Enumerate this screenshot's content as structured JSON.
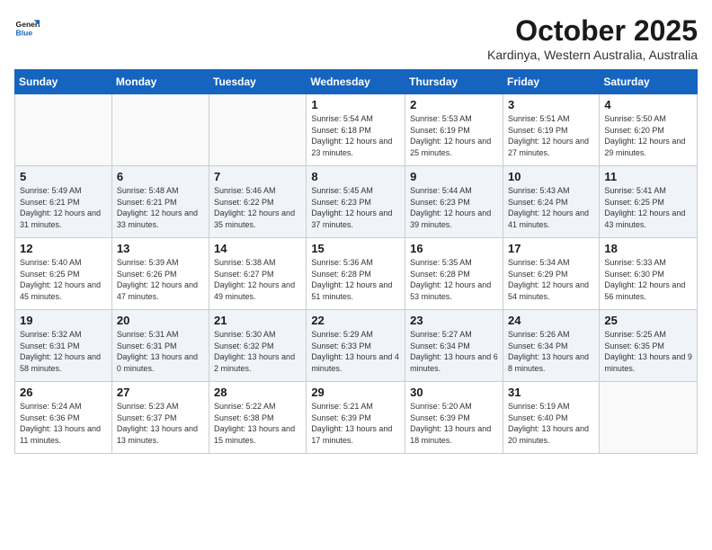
{
  "header": {
    "logo_line1": "General",
    "logo_line2": "Blue",
    "title": "October 2025",
    "location": "Kardinya, Western Australia, Australia"
  },
  "columns": [
    "Sunday",
    "Monday",
    "Tuesday",
    "Wednesday",
    "Thursday",
    "Friday",
    "Saturday"
  ],
  "weeks": [
    [
      {
        "day": "",
        "info": ""
      },
      {
        "day": "",
        "info": ""
      },
      {
        "day": "",
        "info": ""
      },
      {
        "day": "1",
        "info": "Sunrise: 5:54 AM\nSunset: 6:18 PM\nDaylight: 12 hours\nand 23 minutes."
      },
      {
        "day": "2",
        "info": "Sunrise: 5:53 AM\nSunset: 6:19 PM\nDaylight: 12 hours\nand 25 minutes."
      },
      {
        "day": "3",
        "info": "Sunrise: 5:51 AM\nSunset: 6:19 PM\nDaylight: 12 hours\nand 27 minutes."
      },
      {
        "day": "4",
        "info": "Sunrise: 5:50 AM\nSunset: 6:20 PM\nDaylight: 12 hours\nand 29 minutes."
      }
    ],
    [
      {
        "day": "5",
        "info": "Sunrise: 5:49 AM\nSunset: 6:21 PM\nDaylight: 12 hours\nand 31 minutes."
      },
      {
        "day": "6",
        "info": "Sunrise: 5:48 AM\nSunset: 6:21 PM\nDaylight: 12 hours\nand 33 minutes."
      },
      {
        "day": "7",
        "info": "Sunrise: 5:46 AM\nSunset: 6:22 PM\nDaylight: 12 hours\nand 35 minutes."
      },
      {
        "day": "8",
        "info": "Sunrise: 5:45 AM\nSunset: 6:23 PM\nDaylight: 12 hours\nand 37 minutes."
      },
      {
        "day": "9",
        "info": "Sunrise: 5:44 AM\nSunset: 6:23 PM\nDaylight: 12 hours\nand 39 minutes."
      },
      {
        "day": "10",
        "info": "Sunrise: 5:43 AM\nSunset: 6:24 PM\nDaylight: 12 hours\nand 41 minutes."
      },
      {
        "day": "11",
        "info": "Sunrise: 5:41 AM\nSunset: 6:25 PM\nDaylight: 12 hours\nand 43 minutes."
      }
    ],
    [
      {
        "day": "12",
        "info": "Sunrise: 5:40 AM\nSunset: 6:25 PM\nDaylight: 12 hours\nand 45 minutes."
      },
      {
        "day": "13",
        "info": "Sunrise: 5:39 AM\nSunset: 6:26 PM\nDaylight: 12 hours\nand 47 minutes."
      },
      {
        "day": "14",
        "info": "Sunrise: 5:38 AM\nSunset: 6:27 PM\nDaylight: 12 hours\nand 49 minutes."
      },
      {
        "day": "15",
        "info": "Sunrise: 5:36 AM\nSunset: 6:28 PM\nDaylight: 12 hours\nand 51 minutes."
      },
      {
        "day": "16",
        "info": "Sunrise: 5:35 AM\nSunset: 6:28 PM\nDaylight: 12 hours\nand 53 minutes."
      },
      {
        "day": "17",
        "info": "Sunrise: 5:34 AM\nSunset: 6:29 PM\nDaylight: 12 hours\nand 54 minutes."
      },
      {
        "day": "18",
        "info": "Sunrise: 5:33 AM\nSunset: 6:30 PM\nDaylight: 12 hours\nand 56 minutes."
      }
    ],
    [
      {
        "day": "19",
        "info": "Sunrise: 5:32 AM\nSunset: 6:31 PM\nDaylight: 12 hours\nand 58 minutes."
      },
      {
        "day": "20",
        "info": "Sunrise: 5:31 AM\nSunset: 6:31 PM\nDaylight: 13 hours\nand 0 minutes."
      },
      {
        "day": "21",
        "info": "Sunrise: 5:30 AM\nSunset: 6:32 PM\nDaylight: 13 hours\nand 2 minutes."
      },
      {
        "day": "22",
        "info": "Sunrise: 5:29 AM\nSunset: 6:33 PM\nDaylight: 13 hours\nand 4 minutes."
      },
      {
        "day": "23",
        "info": "Sunrise: 5:27 AM\nSunset: 6:34 PM\nDaylight: 13 hours\nand 6 minutes."
      },
      {
        "day": "24",
        "info": "Sunrise: 5:26 AM\nSunset: 6:34 PM\nDaylight: 13 hours\nand 8 minutes."
      },
      {
        "day": "25",
        "info": "Sunrise: 5:25 AM\nSunset: 6:35 PM\nDaylight: 13 hours\nand 9 minutes."
      }
    ],
    [
      {
        "day": "26",
        "info": "Sunrise: 5:24 AM\nSunset: 6:36 PM\nDaylight: 13 hours\nand 11 minutes."
      },
      {
        "day": "27",
        "info": "Sunrise: 5:23 AM\nSunset: 6:37 PM\nDaylight: 13 hours\nand 13 minutes."
      },
      {
        "day": "28",
        "info": "Sunrise: 5:22 AM\nSunset: 6:38 PM\nDaylight: 13 hours\nand 15 minutes."
      },
      {
        "day": "29",
        "info": "Sunrise: 5:21 AM\nSunset: 6:39 PM\nDaylight: 13 hours\nand 17 minutes."
      },
      {
        "day": "30",
        "info": "Sunrise: 5:20 AM\nSunset: 6:39 PM\nDaylight: 13 hours\nand 18 minutes."
      },
      {
        "day": "31",
        "info": "Sunrise: 5:19 AM\nSunset: 6:40 PM\nDaylight: 13 hours\nand 20 minutes."
      },
      {
        "day": "",
        "info": ""
      }
    ]
  ]
}
